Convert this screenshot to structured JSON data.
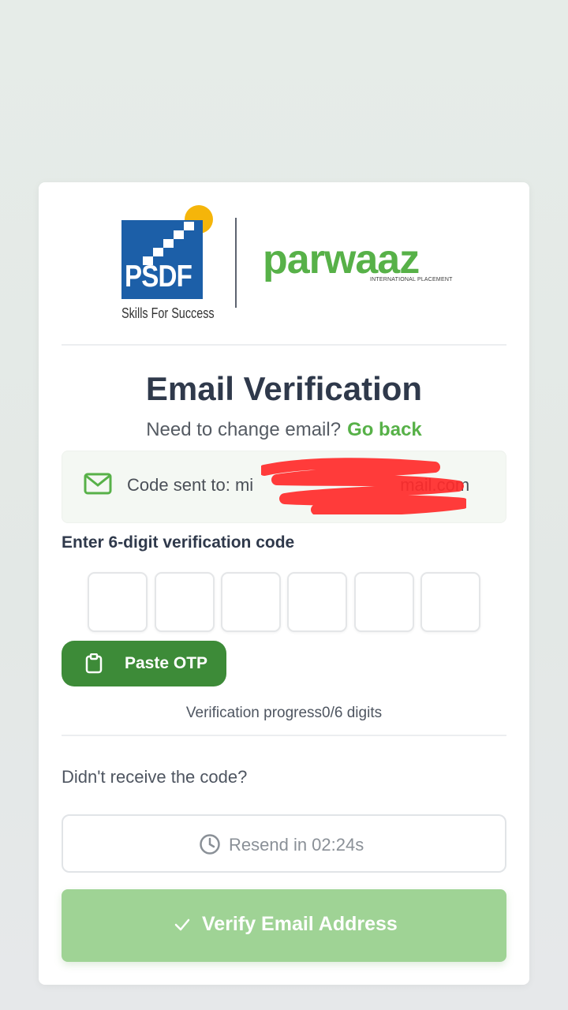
{
  "branding": {
    "psdf_logo_text": "PSDF",
    "psdf_tagline": "Skills For Success",
    "parwaaz_logo_text": "parwaaz",
    "parwaaz_subtext": "INTERNATIONAL PLACEMENT"
  },
  "heading": {
    "title": "Email Verification",
    "change_prompt": "Need to change email?",
    "go_back_label": "Go back"
  },
  "email_notice": {
    "icon": "envelope-icon",
    "prefix": "Code sent to: mi",
    "suffix": "mail.com"
  },
  "otp": {
    "label": "Enter 6-digit verification code",
    "digits": [
      "",
      "",
      "",
      "",
      "",
      ""
    ],
    "paste_label": "Paste OTP",
    "paste_icon": "clipboard-icon",
    "progress_text": "Verification progress0/6 digits"
  },
  "resend": {
    "prompt": "Didn't receive the code?",
    "button_label": "Resend in 02:24s",
    "icon": "clock-icon"
  },
  "verify": {
    "button_label": "Verify Email Address",
    "icon": "check-icon"
  },
  "colors": {
    "accent_green": "#57b148",
    "paste_button": "#3d8b38",
    "verify_button_disabled": "#9fd395",
    "psdf_blue": "#1c5fa8",
    "psdf_sun": "#f5b50a"
  }
}
